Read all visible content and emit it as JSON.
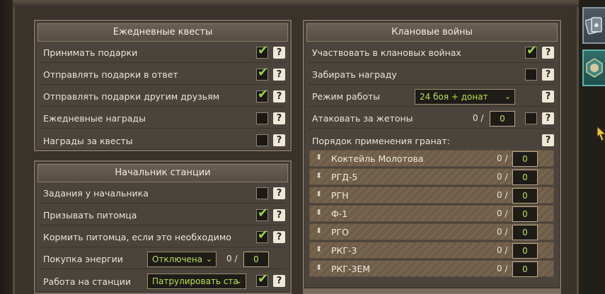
{
  "daily_quests": {
    "title": "Ежедневные квесты",
    "rows": [
      {
        "label": "Принимать подарки",
        "checked": true
      },
      {
        "label": "Отправлять подарки в ответ",
        "checked": true
      },
      {
        "label": "Отправлять подарки другим друзьям",
        "checked": true
      },
      {
        "label": "Ежедневные награды",
        "checked": false
      },
      {
        "label": "Награды за квесты",
        "checked": false
      }
    ]
  },
  "station_chief": {
    "title": "Начальник станции",
    "rows": [
      {
        "label": "Задания у начальника",
        "checked": false
      },
      {
        "label": "Призывать питомца",
        "checked": true
      },
      {
        "label": "Кормить питомца, если это необходимо",
        "checked": true
      }
    ],
    "energy": {
      "label": "Покупка энергии",
      "select": "Отключена",
      "zero": "0 /",
      "value": "0"
    },
    "work": {
      "label": "Работа на станции",
      "select": "Патрулировать ста",
      "checked": true
    }
  },
  "clan_wars": {
    "title": "Клановые войны",
    "participate": {
      "label": "Участвовать в клановых войнах",
      "checked": true
    },
    "reward": {
      "label": "Забирать награду",
      "checked": false
    },
    "mode": {
      "label": "Режим работы",
      "select": "24 боя + донат"
    },
    "tokens": {
      "label": "Атаковать за жетоны",
      "zero": "0 /",
      "value": "0",
      "checked": false
    },
    "grenades_header": "Порядок применения гранат:",
    "grenades": [
      {
        "name": "Коктейль Молотова",
        "zero": "0 /",
        "value": "0"
      },
      {
        "name": "РГД-5",
        "zero": "0 /",
        "value": "0"
      },
      {
        "name": "РГН",
        "zero": "0 /",
        "value": "0"
      },
      {
        "name": "Ф-1",
        "zero": "0 /",
        "value": "0"
      },
      {
        "name": "РГО",
        "zero": "0 /",
        "value": "0"
      },
      {
        "name": "РКГ-3",
        "zero": "0 /",
        "value": "0"
      },
      {
        "name": "РКГ-3ЕМ",
        "zero": "0 /",
        "value": "0"
      }
    ]
  },
  "common": {
    "help": "?",
    "check": "✔",
    "chevron": "⌄",
    "drag": "⬍"
  },
  "colors": {
    "accent_green": "#9ad63a",
    "panel": "#4b443c"
  }
}
